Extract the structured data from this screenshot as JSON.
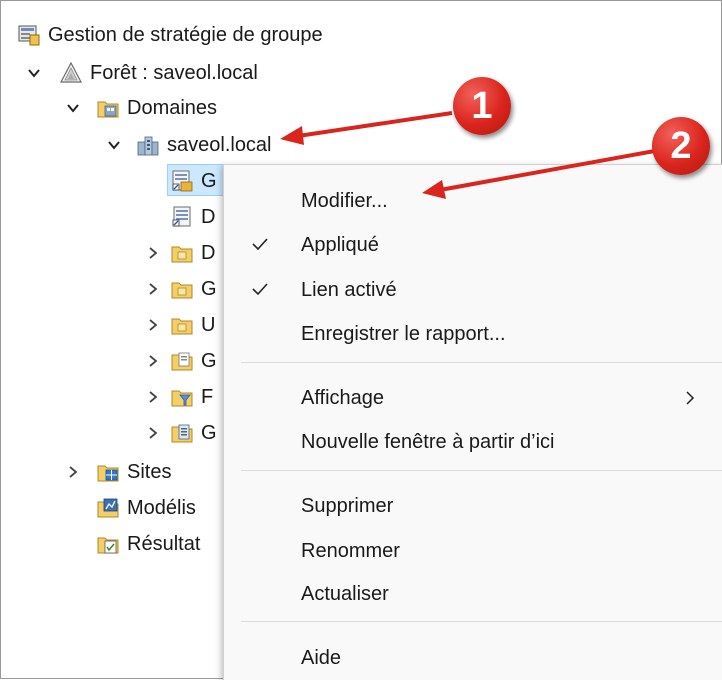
{
  "tree": {
    "root": "Gestion de stratégie de groupe",
    "forest": "Forêt : saveol.local",
    "domains": "Domaines",
    "domain": "saveol.local",
    "children_truncated": [
      "G",
      "D",
      "D",
      "G",
      "U",
      "G",
      "F",
      "G"
    ],
    "sites": "Sites",
    "modeling": "Modélis",
    "results": "Résultat"
  },
  "context_menu": {
    "items": [
      {
        "label": "Modifier...",
        "checked": false
      },
      {
        "label": "Appliqué",
        "checked": true
      },
      {
        "label": "Lien activé",
        "checked": true
      },
      {
        "label": "Enregistrer le rapport...",
        "checked": false
      },
      {
        "label": "Affichage",
        "checked": false,
        "submenu": true
      },
      {
        "label": "Nouvelle fenêtre à partir d’ici",
        "checked": false
      },
      {
        "label": "Supprimer",
        "checked": false
      },
      {
        "label": "Renommer",
        "checked": false
      },
      {
        "label": "Actualiser",
        "checked": false
      },
      {
        "label": "Aide",
        "checked": false
      }
    ]
  },
  "annotations": {
    "badge1": "1",
    "badge2": "2",
    "color": "#d9251d"
  }
}
